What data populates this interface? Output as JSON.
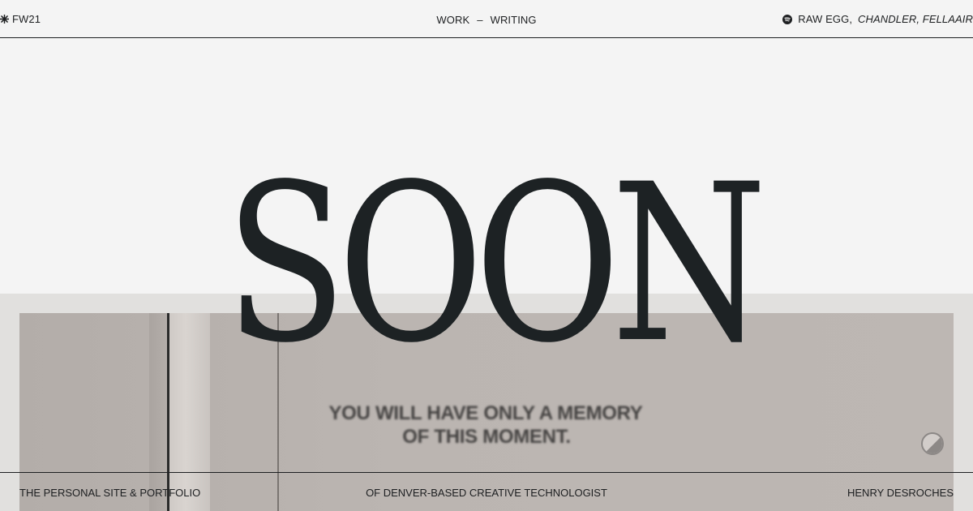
{
  "header": {
    "brand": "FW21",
    "brand_icon": "starburst-icon",
    "nav": {
      "work": "WORK",
      "separator": "–",
      "writing": "WRITING"
    },
    "now_playing": {
      "icon": "spotify-icon",
      "title": "RAW EGG,",
      "artists": "CHANDLER, FELLAAIR"
    }
  },
  "hero": {
    "headline": "SOON",
    "memory_line1": "YOU WILL HAVE ONLY A MEMORY",
    "memory_line2": "OF THIS MOMENT."
  },
  "footer": {
    "left": "THE PERSONAL SITE & PORTFOLIO",
    "center": "OF DENVER-BASED CREATIVE TECHNOLOGIST",
    "right": "HENRY DESROCHES"
  },
  "colors": {
    "background": "#f4f4f4",
    "text": "#1d1f21",
    "panel": "#e1e0de",
    "photo": "#bbb5b1"
  }
}
